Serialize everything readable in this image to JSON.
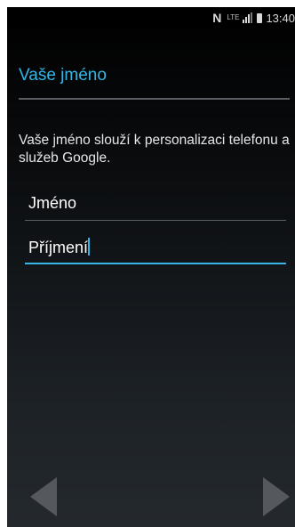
{
  "status_bar": {
    "nfc_icon": "N",
    "network_label": "LTE",
    "time": "13:40"
  },
  "page": {
    "title": "Vaše jméno",
    "description": "Vaše jméno slouží k personalizaci telefonu a služeb Google."
  },
  "form": {
    "first_name_value": "Jméno",
    "last_name_value": "Příjmení"
  },
  "navigation": {
    "back_icon": "triangle-left",
    "next_icon": "triangle-right"
  },
  "colors": {
    "accent": "#33b5e5",
    "background_top": "#000000",
    "background_bottom": "#24292e"
  }
}
